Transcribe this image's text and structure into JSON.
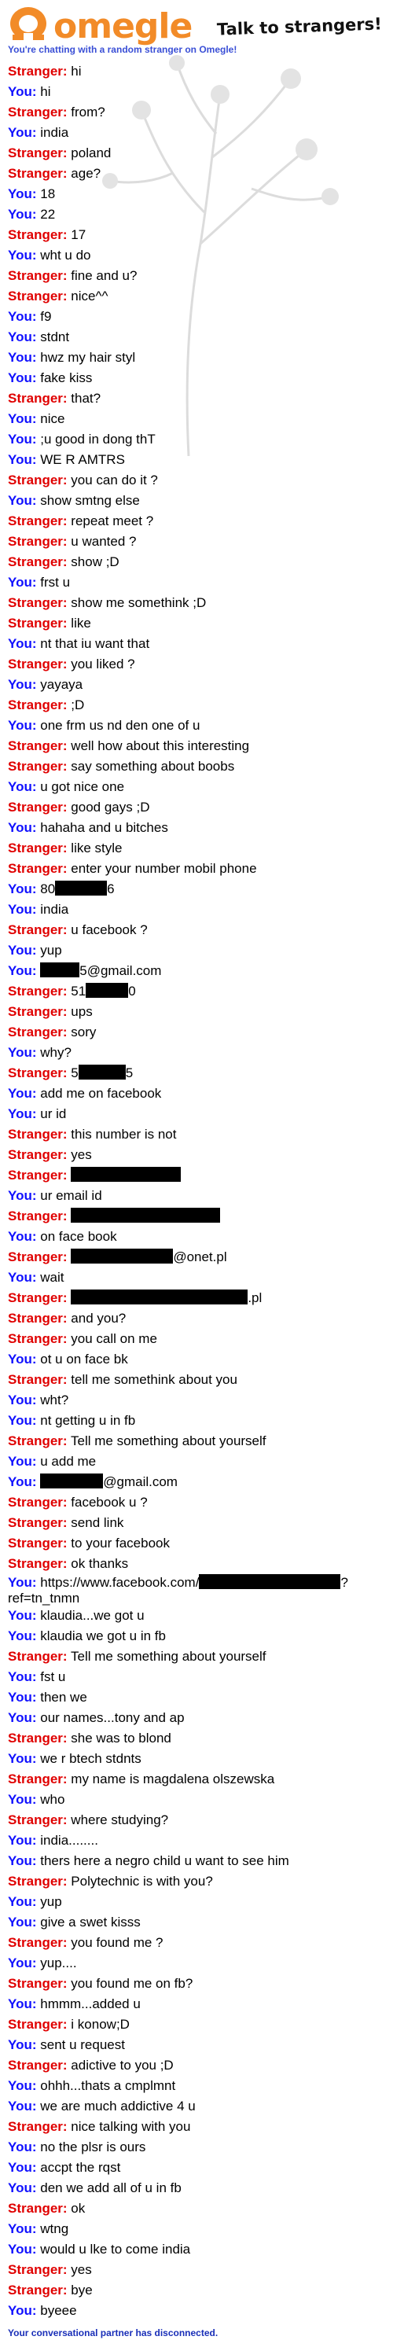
{
  "header": {
    "logo_text": "omegle",
    "tagline": "Talk to strangers!",
    "subtitle": "You're chatting with a random stranger on Omegle!"
  },
  "labels": {
    "stranger": "Stranger:",
    "you": "You:"
  },
  "messages": [
    {
      "who": "stranger",
      "parts": [
        {
          "t": " hi"
        }
      ]
    },
    {
      "who": "you",
      "parts": [
        {
          "t": " hi"
        }
      ]
    },
    {
      "who": "stranger",
      "parts": [
        {
          "t": " from?"
        }
      ]
    },
    {
      "who": "you",
      "parts": [
        {
          "t": " india"
        }
      ]
    },
    {
      "who": "stranger",
      "parts": [
        {
          "t": " poland"
        }
      ]
    },
    {
      "who": "stranger",
      "parts": [
        {
          "t": " age?"
        }
      ]
    },
    {
      "who": "you",
      "parts": [
        {
          "t": " 18"
        }
      ]
    },
    {
      "who": "you",
      "parts": [
        {
          "t": " 22"
        }
      ]
    },
    {
      "who": "stranger",
      "parts": [
        {
          "t": " 17"
        }
      ]
    },
    {
      "who": "you",
      "parts": [
        {
          "t": " wht u do"
        }
      ]
    },
    {
      "who": "stranger",
      "parts": [
        {
          "t": " fine and u?"
        }
      ]
    },
    {
      "who": "stranger",
      "parts": [
        {
          "t": " nice^^"
        }
      ]
    },
    {
      "who": "you",
      "parts": [
        {
          "t": " f9"
        }
      ]
    },
    {
      "who": "you",
      "parts": [
        {
          "t": " stdnt"
        }
      ]
    },
    {
      "who": "you",
      "parts": [
        {
          "t": " hwz my hair styl"
        }
      ]
    },
    {
      "who": "you",
      "parts": [
        {
          "t": " fake kiss"
        }
      ]
    },
    {
      "who": "stranger",
      "parts": [
        {
          "t": " that?"
        }
      ]
    },
    {
      "who": "you",
      "parts": [
        {
          "t": " nice"
        }
      ]
    },
    {
      "who": "you",
      "parts": [
        {
          "t": " ;u good in dong thT"
        }
      ]
    },
    {
      "who": "you",
      "parts": [
        {
          "t": " WE R AMTRS"
        }
      ]
    },
    {
      "who": "stranger",
      "parts": [
        {
          "t": " you can do it ?"
        }
      ]
    },
    {
      "who": "you",
      "parts": [
        {
          "t": " show smtng else"
        }
      ]
    },
    {
      "who": "stranger",
      "parts": [
        {
          "t": " repeat meet ?"
        }
      ]
    },
    {
      "who": "stranger",
      "parts": [
        {
          "t": " u wanted ?"
        }
      ]
    },
    {
      "who": "stranger",
      "parts": [
        {
          "t": " show ;D"
        }
      ]
    },
    {
      "who": "you",
      "parts": [
        {
          "t": " frst u"
        }
      ]
    },
    {
      "who": "stranger",
      "parts": [
        {
          "t": " show me somethink ;D"
        }
      ]
    },
    {
      "who": "stranger",
      "parts": [
        {
          "t": " like"
        }
      ]
    },
    {
      "who": "you",
      "parts": [
        {
          "t": " nt that iu want that"
        }
      ]
    },
    {
      "who": "stranger",
      "parts": [
        {
          "t": " you liked ?"
        }
      ]
    },
    {
      "who": "you",
      "parts": [
        {
          "t": " yayaya"
        }
      ]
    },
    {
      "who": "stranger",
      "parts": [
        {
          "t": " ;D"
        }
      ]
    },
    {
      "who": "you",
      "parts": [
        {
          "t": " one frm us nd den one of u"
        }
      ]
    },
    {
      "who": "stranger",
      "parts": [
        {
          "t": " well how about this interesting"
        }
      ]
    },
    {
      "who": "stranger",
      "parts": [
        {
          "t": " say something about boobs"
        }
      ]
    },
    {
      "who": "you",
      "parts": [
        {
          "t": " u got nice one"
        }
      ]
    },
    {
      "who": "stranger",
      "parts": [
        {
          "t": " good gays ;D"
        }
      ]
    },
    {
      "who": "you",
      "parts": [
        {
          "t": " hahaha  and u bitches"
        }
      ]
    },
    {
      "who": "stranger",
      "parts": [
        {
          "t": " like style"
        }
      ]
    },
    {
      "who": "stranger",
      "parts": [
        {
          "t": " enter your number mobil phone"
        }
      ]
    },
    {
      "who": "you",
      "parts": [
        {
          "t": " 80"
        },
        {
          "r": "black"
        },
        {
          "t": "6"
        }
      ]
    },
    {
      "who": "you",
      "parts": [
        {
          "t": " india"
        }
      ]
    },
    {
      "who": "stranger",
      "parts": [
        {
          "t": " u facebook ?"
        }
      ]
    },
    {
      "who": "you",
      "parts": [
        {
          "t": " yup"
        }
      ]
    },
    {
      "who": "you",
      "parts": [
        {
          "t": " "
        },
        {
          "r": "black"
        },
        {
          "t": "5@gmail.com"
        }
      ]
    },
    {
      "who": "stranger",
      "parts": [
        {
          "t": " 51"
        },
        {
          "r": "black"
        },
        {
          "t": "0"
        }
      ]
    },
    {
      "who": "stranger",
      "parts": [
        {
          "t": " ups"
        }
      ]
    },
    {
      "who": "stranger",
      "parts": [
        {
          "t": " sory"
        }
      ]
    },
    {
      "who": "you",
      "parts": [
        {
          "t": " why?"
        }
      ]
    },
    {
      "who": "stranger",
      "parts": [
        {
          "t": " 5"
        },
        {
          "r": "black"
        },
        {
          "t": "5"
        }
      ]
    },
    {
      "who": "you",
      "parts": [
        {
          "t": " add me on facebook"
        }
      ]
    },
    {
      "who": "you",
      "parts": [
        {
          "t": " ur id"
        }
      ]
    },
    {
      "who": "stranger",
      "parts": [
        {
          "t": " this number is not"
        }
      ]
    },
    {
      "who": "stranger",
      "parts": [
        {
          "t": " yes"
        }
      ]
    },
    {
      "who": "stranger",
      "parts": [
        {
          "t": " "
        },
        {
          "r": "black"
        }
      ]
    },
    {
      "who": "you",
      "parts": [
        {
          "t": " ur email id"
        }
      ]
    },
    {
      "who": "stranger",
      "parts": [
        {
          "t": " "
        },
        {
          "r": "black"
        }
      ]
    },
    {
      "who": "you",
      "parts": [
        {
          "t": " on face book"
        }
      ]
    },
    {
      "who": "stranger",
      "parts": [
        {
          "t": " "
        },
        {
          "r": "black"
        },
        {
          "t": "@onet.pl"
        }
      ]
    },
    {
      "who": "you",
      "parts": [
        {
          "t": " wait"
        }
      ]
    },
    {
      "who": "stranger",
      "parts": [
        {
          "t": " "
        },
        {
          "r": "black"
        },
        {
          "t": ".pl"
        }
      ]
    },
    {
      "who": "stranger",
      "parts": [
        {
          "t": " and you?"
        }
      ]
    },
    {
      "who": "stranger",
      "parts": [
        {
          "t": " you call on me"
        }
      ]
    },
    {
      "who": "you",
      "parts": [
        {
          "t": " ot u on face bk"
        }
      ]
    },
    {
      "who": "stranger",
      "parts": [
        {
          "t": " tell me somethink about you"
        }
      ]
    },
    {
      "who": "you",
      "parts": [
        {
          "t": " wht?"
        }
      ]
    },
    {
      "who": "you",
      "parts": [
        {
          "t": " nt getting u in fb"
        }
      ]
    },
    {
      "who": "stranger",
      "parts": [
        {
          "t": " Tell me something about yourself"
        }
      ]
    },
    {
      "who": "you",
      "parts": [
        {
          "t": " u add me"
        }
      ]
    },
    {
      "who": "you",
      "parts": [
        {
          "t": " "
        },
        {
          "r": "black"
        },
        {
          "t": "@gmail.com"
        }
      ]
    },
    {
      "who": "stranger",
      "parts": [
        {
          "t": " facebook u ?"
        }
      ]
    },
    {
      "who": "stranger",
      "parts": [
        {
          "t": " send link"
        }
      ]
    },
    {
      "who": "stranger",
      "parts": [
        {
          "t": " to your facebook"
        }
      ]
    },
    {
      "who": "stranger",
      "parts": [
        {
          "t": " ok thanks"
        }
      ]
    },
    {
      "who": "you",
      "tall": true,
      "parts": [
        {
          "t": " https://www.facebook.com/"
        },
        {
          "r": "black"
        },
        {
          "t": "?"
        },
        {
          "br": true
        },
        {
          "t": "ref=tn_tnmn"
        }
      ]
    },
    {
      "who": "you",
      "parts": [
        {
          "t": " klaudia...we got u"
        }
      ]
    },
    {
      "who": "you",
      "parts": [
        {
          "t": " klaudia we got u in fb"
        }
      ]
    },
    {
      "who": "stranger",
      "parts": [
        {
          "t": " Tell me something about yourself"
        }
      ]
    },
    {
      "who": "you",
      "parts": [
        {
          "t": " fst u"
        }
      ]
    },
    {
      "who": "you",
      "parts": [
        {
          "t": " then we"
        }
      ]
    },
    {
      "who": "you",
      "parts": [
        {
          "t": " our names...tony and ap"
        }
      ]
    },
    {
      "who": "stranger",
      "parts": [
        {
          "t": " she was to blond"
        }
      ]
    },
    {
      "who": "you",
      "parts": [
        {
          "t": " we r btech stdnts"
        }
      ]
    },
    {
      "who": "stranger",
      "parts": [
        {
          "t": " my name is magdalena olszewska"
        }
      ]
    },
    {
      "who": "you",
      "parts": [
        {
          "t": " who"
        }
      ]
    },
    {
      "who": "stranger",
      "parts": [
        {
          "t": " where studying?"
        }
      ]
    },
    {
      "who": "you",
      "parts": [
        {
          "t": " india........"
        }
      ]
    },
    {
      "who": "you",
      "parts": [
        {
          "t": " thers here a negro child u want to see him"
        }
      ]
    },
    {
      "who": "stranger",
      "parts": [
        {
          "t": " Polytechnic is with you?"
        }
      ]
    },
    {
      "who": "you",
      "parts": [
        {
          "t": " yup"
        }
      ]
    },
    {
      "who": "you",
      "parts": [
        {
          "t": " give a swet kisss"
        }
      ]
    },
    {
      "who": "stranger",
      "parts": [
        {
          "t": " you found me ?"
        }
      ]
    },
    {
      "who": "you",
      "parts": [
        {
          "t": " yup...."
        }
      ]
    },
    {
      "who": "stranger",
      "parts": [
        {
          "t": " you found me on fb?"
        }
      ]
    },
    {
      "who": "you",
      "parts": [
        {
          "t": " hmmm...added u"
        }
      ]
    },
    {
      "who": "stranger",
      "parts": [
        {
          "t": " i konow;D"
        }
      ]
    },
    {
      "who": "you",
      "parts": [
        {
          "t": " sent u request"
        }
      ]
    },
    {
      "who": "stranger",
      "parts": [
        {
          "t": " adictive to you ;D"
        }
      ]
    },
    {
      "who": "you",
      "parts": [
        {
          "t": " ohhh...thats a cmplmnt"
        }
      ]
    },
    {
      "who": "you",
      "parts": [
        {
          "t": " we are much addictive 4 u"
        }
      ]
    },
    {
      "who": "stranger",
      "parts": [
        {
          "t": " nice talking with you"
        }
      ]
    },
    {
      "who": "you",
      "parts": [
        {
          "t": " no the plsr is ours"
        }
      ]
    },
    {
      "who": "you",
      "parts": [
        {
          "t": " accpt the rqst"
        }
      ]
    },
    {
      "who": "you",
      "parts": [
        {
          "t": " den we add all of u in fb"
        }
      ]
    },
    {
      "who": "stranger",
      "parts": [
        {
          "t": " ok"
        }
      ]
    },
    {
      "who": "you",
      "parts": [
        {
          "t": " wtng"
        }
      ]
    },
    {
      "who": "you",
      "parts": [
        {
          "t": " would u lke to come india"
        }
      ]
    },
    {
      "who": "stranger",
      "parts": [
        {
          "t": " yes"
        }
      ]
    },
    {
      "who": "stranger",
      "parts": [
        {
          "t": " bye"
        }
      ]
    },
    {
      "who": "you",
      "parts": [
        {
          "t": " byeee"
        }
      ]
    }
  ],
  "status_text": "Your conversational partner has disconnected.",
  "colors": {
    "brand": "#f28b28",
    "stranger": "#e00000",
    "you": "#1010ff",
    "status": "#1a2fb8"
  }
}
